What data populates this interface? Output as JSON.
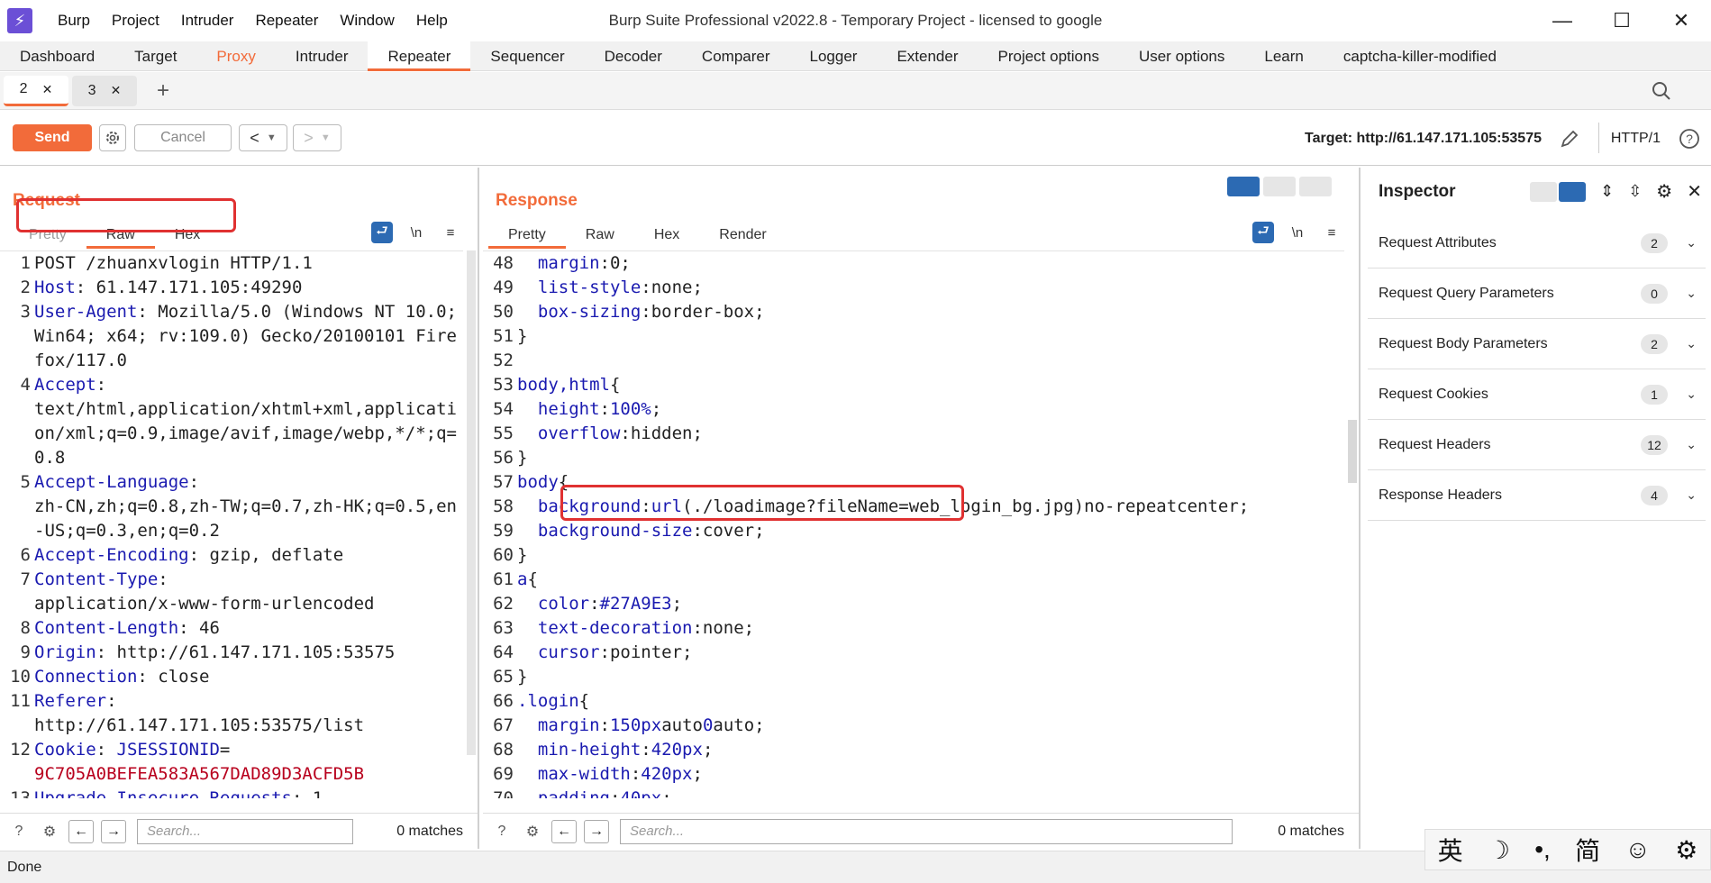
{
  "window": {
    "title": "Burp Suite Professional v2022.8 - Temporary Project - licensed to google",
    "menu": [
      "Burp",
      "Project",
      "Intruder",
      "Repeater",
      "Window",
      "Help"
    ]
  },
  "main_tabs": [
    "Dashboard",
    "Target",
    "Proxy",
    "Intruder",
    "Repeater",
    "Sequencer",
    "Decoder",
    "Comparer",
    "Logger",
    "Extender",
    "Project options",
    "User options",
    "Learn",
    "captcha-killer-modified"
  ],
  "repeater_tabs": [
    "2",
    "3"
  ],
  "toolbar": {
    "send": "Send",
    "cancel": "Cancel",
    "target": "Target: http://61.147.171.105:53575",
    "http_version": "HTTP/1"
  },
  "request": {
    "title": "Request",
    "tabs": [
      "Pretty",
      "Raw",
      "Hex"
    ],
    "active_tab": "Raw",
    "newline_label": "\\n",
    "lines": [
      {
        "n": "1",
        "segs": [
          [
            "plain",
            "POST /zhuanxvlogin HTTP/1.1"
          ]
        ]
      },
      {
        "n": "2",
        "segs": [
          [
            "hname",
            "Host"
          ],
          [
            "plain",
            ": 61.147.171.105:49290"
          ]
        ]
      },
      {
        "n": "3",
        "segs": [
          [
            "hname",
            "User-Agent"
          ],
          [
            "plain",
            ": Mozilla/5.0 (Windows NT 10.0; Win64; x64; rv:109.0) Gecko/20100101 Firefox/117.0"
          ]
        ]
      },
      {
        "n": "4",
        "segs": [
          [
            "hname",
            "Accept"
          ],
          [
            "plain",
            ":\ntext/html,application/xhtml+xml,application/xml;q=0.9,image/avif,image/webp,*/*;q=0.8"
          ]
        ]
      },
      {
        "n": "5",
        "segs": [
          [
            "hname",
            "Accept-Language"
          ],
          [
            "plain",
            ":\nzh-CN,zh;q=0.8,zh-TW;q=0.7,zh-HK;q=0.5,en-US;q=0.3,en;q=0.2"
          ]
        ]
      },
      {
        "n": "6",
        "segs": [
          [
            "hname",
            "Accept-Encoding"
          ],
          [
            "plain",
            ": gzip, deflate"
          ]
        ]
      },
      {
        "n": "7",
        "segs": [
          [
            "hname",
            "Content-Type"
          ],
          [
            "plain",
            ":\napplication/x-www-form-urlencoded"
          ]
        ]
      },
      {
        "n": "8",
        "segs": [
          [
            "hname",
            "Content-Length"
          ],
          [
            "plain",
            ": 46"
          ]
        ]
      },
      {
        "n": "9",
        "segs": [
          [
            "hname",
            "Origin"
          ],
          [
            "plain",
            ": http://61.147.171.105:53575"
          ]
        ]
      },
      {
        "n": "10",
        "segs": [
          [
            "hname",
            "Connection"
          ],
          [
            "plain",
            ": close"
          ]
        ]
      },
      {
        "n": "11",
        "segs": [
          [
            "hname",
            "Referer"
          ],
          [
            "plain",
            ":\nhttp://61.147.171.105:53575/list"
          ]
        ]
      },
      {
        "n": "12",
        "segs": [
          [
            "hname",
            "Cookie"
          ],
          [
            "plain",
            ": "
          ],
          [
            "hname",
            "JSESSIONID"
          ],
          [
            "plain",
            "=\n"
          ],
          [
            "cookie-val",
            "9C705A0BEFEA583A567DAD89D3ACFD5B"
          ]
        ]
      },
      {
        "n": "13",
        "segs": [
          [
            "hname",
            "Upgrade-Insecure-Requests"
          ],
          [
            "plain",
            ": 1"
          ]
        ]
      }
    ],
    "search_placeholder": "Search...",
    "matches": "0 matches"
  },
  "response": {
    "title": "Response",
    "tabs": [
      "Pretty",
      "Raw",
      "Hex",
      "Render"
    ],
    "active_tab": "Pretty",
    "newline_label": "\\n",
    "lines": [
      {
        "n": "48",
        "segs": [
          [
            "plain",
            "  "
          ],
          [
            "prop",
            "margin"
          ],
          [
            "plain",
            ":0;"
          ]
        ]
      },
      {
        "n": "49",
        "segs": [
          [
            "plain",
            "  "
          ],
          [
            "prop",
            "list-style"
          ],
          [
            "plain",
            ":none;"
          ]
        ]
      },
      {
        "n": "50",
        "segs": [
          [
            "plain",
            "  "
          ],
          [
            "prop",
            "box-sizing"
          ],
          [
            "plain",
            ":border-box;"
          ]
        ]
      },
      {
        "n": "51",
        "segs": [
          [
            "plain",
            "}"
          ]
        ]
      },
      {
        "n": "52",
        "segs": [
          [
            "plain",
            ""
          ]
        ]
      },
      {
        "n": "53",
        "segs": [
          [
            "css-sel",
            "body,html"
          ],
          [
            "plain",
            "{"
          ]
        ]
      },
      {
        "n": "54",
        "segs": [
          [
            "plain",
            "  "
          ],
          [
            "prop",
            "height"
          ],
          [
            "plain",
            ":"
          ],
          [
            "num",
            "100%"
          ],
          [
            "plain",
            ";"
          ]
        ]
      },
      {
        "n": "55",
        "segs": [
          [
            "plain",
            "  "
          ],
          [
            "prop",
            "overflow"
          ],
          [
            "plain",
            ":hidden;"
          ]
        ]
      },
      {
        "n": "56",
        "segs": [
          [
            "plain",
            "}"
          ]
        ]
      },
      {
        "n": "57",
        "segs": [
          [
            "css-sel",
            "body"
          ],
          [
            "plain",
            "{"
          ]
        ]
      },
      {
        "n": "58",
        "segs": [
          [
            "plain",
            "  "
          ],
          [
            "prop",
            "background"
          ],
          [
            "plain",
            ":"
          ],
          [
            "prop",
            "url"
          ],
          [
            "plain",
            "(./loadimage?fileName=web_login_bg.jpg)no-repeatcenter;"
          ]
        ]
      },
      {
        "n": "59",
        "segs": [
          [
            "plain",
            "  "
          ],
          [
            "prop",
            "background-size"
          ],
          [
            "plain",
            ":cover;"
          ]
        ]
      },
      {
        "n": "60",
        "segs": [
          [
            "plain",
            "}"
          ]
        ]
      },
      {
        "n": "61",
        "segs": [
          [
            "css-sel",
            "a"
          ],
          [
            "plain",
            "{"
          ]
        ]
      },
      {
        "n": "62",
        "segs": [
          [
            "plain",
            "  "
          ],
          [
            "prop",
            "color"
          ],
          [
            "plain",
            ":"
          ],
          [
            "num",
            "#27A9E3"
          ],
          [
            "plain",
            ";"
          ]
        ]
      },
      {
        "n": "63",
        "segs": [
          [
            "plain",
            "  "
          ],
          [
            "prop",
            "text-decoration"
          ],
          [
            "plain",
            ":none;"
          ]
        ]
      },
      {
        "n": "64",
        "segs": [
          [
            "plain",
            "  "
          ],
          [
            "prop",
            "cursor"
          ],
          [
            "plain",
            ":pointer;"
          ]
        ]
      },
      {
        "n": "65",
        "segs": [
          [
            "plain",
            "}"
          ]
        ]
      },
      {
        "n": "66",
        "segs": [
          [
            "css-sel",
            ".login"
          ],
          [
            "plain",
            "{"
          ]
        ]
      },
      {
        "n": "67",
        "segs": [
          [
            "plain",
            "  "
          ],
          [
            "prop",
            "margin"
          ],
          [
            "plain",
            ":"
          ],
          [
            "num",
            "150px"
          ],
          [
            "plain",
            "auto"
          ],
          [
            "num",
            "0"
          ],
          [
            "plain",
            "auto;"
          ]
        ]
      },
      {
        "n": "68",
        "segs": [
          [
            "plain",
            "  "
          ],
          [
            "prop",
            "min-height"
          ],
          [
            "plain",
            ":"
          ],
          [
            "num",
            "420px"
          ],
          [
            "plain",
            ";"
          ]
        ]
      },
      {
        "n": "69",
        "segs": [
          [
            "plain",
            "  "
          ],
          [
            "prop",
            "max-width"
          ],
          [
            "plain",
            ":"
          ],
          [
            "num",
            "420px"
          ],
          [
            "plain",
            ";"
          ]
        ]
      },
      {
        "n": "70",
        "segs": [
          [
            "plain",
            "  "
          ],
          [
            "prop",
            "padding"
          ],
          [
            "plain",
            ":"
          ],
          [
            "num",
            "40px"
          ],
          [
            "plain",
            ";"
          ]
        ]
      }
    ],
    "search_placeholder": "Search...",
    "matches": "0 matches"
  },
  "inspector": {
    "title": "Inspector",
    "sections": [
      {
        "label": "Request Attributes",
        "count": "2"
      },
      {
        "label": "Request Query Parameters",
        "count": "0"
      },
      {
        "label": "Request Body Parameters",
        "count": "2"
      },
      {
        "label": "Request Cookies",
        "count": "1"
      },
      {
        "label": "Request Headers",
        "count": "12"
      },
      {
        "label": "Response Headers",
        "count": "4"
      }
    ]
  },
  "status": {
    "text": "Done"
  },
  "ime": [
    "英",
    "☽",
    "•,",
    "简",
    "☺",
    "⚙"
  ],
  "colors": {
    "accent": "#f26b3a",
    "header_name": "#1a1ab0",
    "cookie_value": "#b8001d",
    "highlight": "#e03131"
  }
}
